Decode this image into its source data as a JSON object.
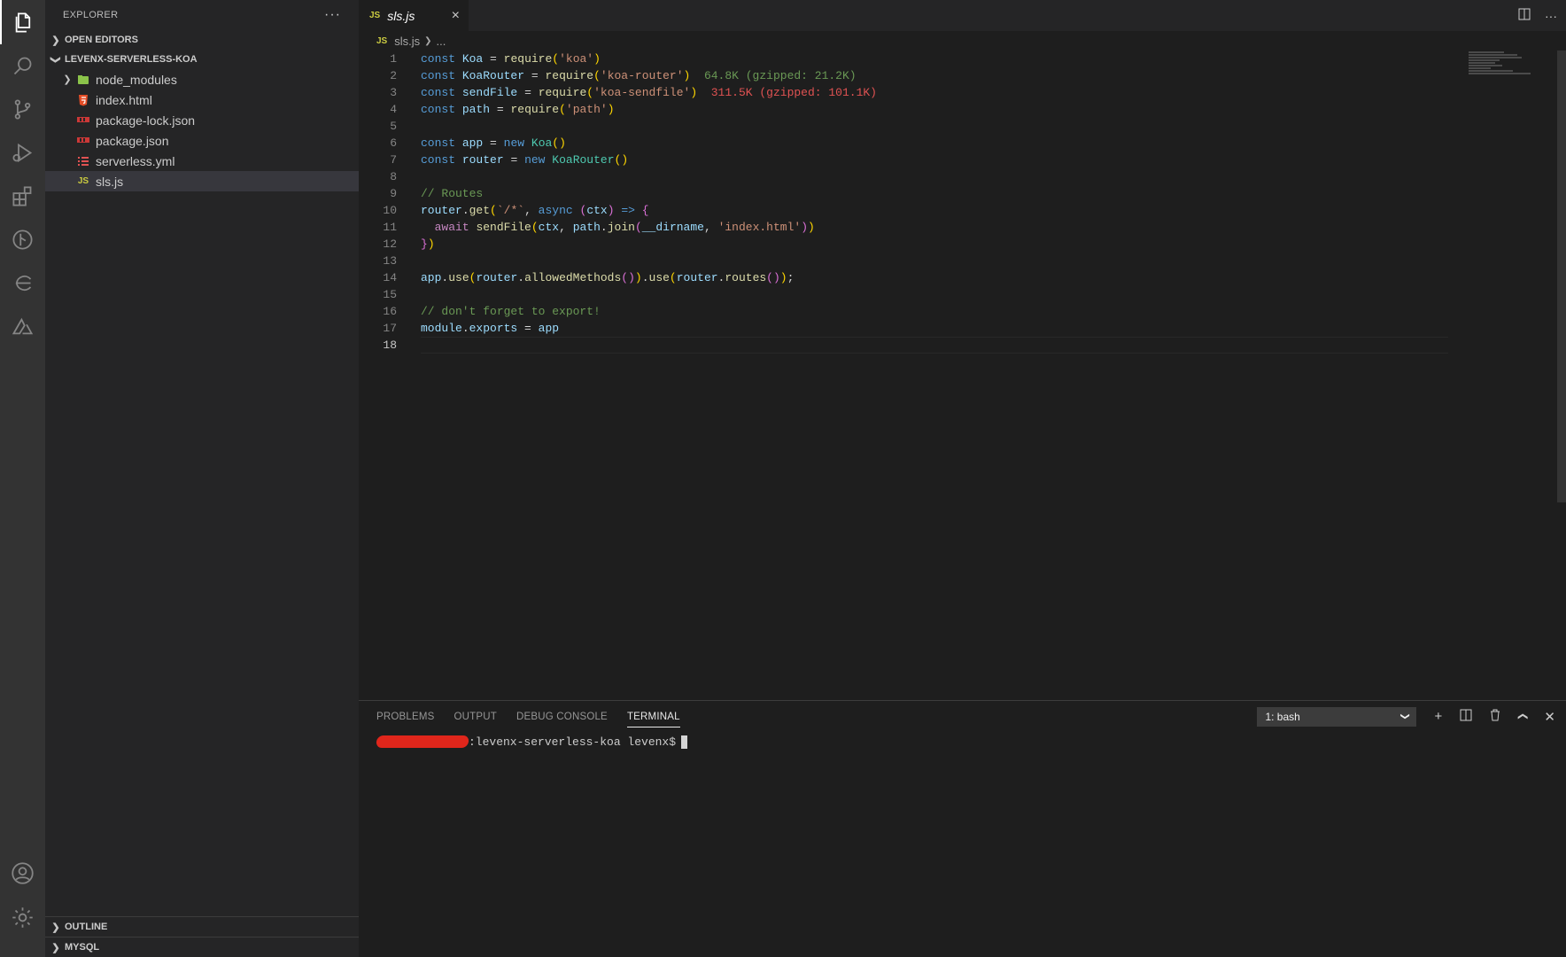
{
  "activity": {
    "icons": [
      "files-icon",
      "search-icon",
      "source-control-icon",
      "run-debug-icon",
      "extensions-icon",
      "git-graph-icon",
      "remote-explorer-icon",
      "azure-icon"
    ],
    "bottom_icons": [
      "account-icon",
      "gear-icon"
    ]
  },
  "sidebar": {
    "title": "EXPLORER",
    "more": "···",
    "open_editors": "OPEN EDITORS",
    "project": "LEVENX-SERVERLESS-KOA",
    "files": [
      {
        "name": "node_modules",
        "icon": "folder-node-icon",
        "kind": "folder"
      },
      {
        "name": "index.html",
        "icon": "html-file-icon",
        "kind": "file"
      },
      {
        "name": "package-lock.json",
        "icon": "npm-file-icon",
        "kind": "file"
      },
      {
        "name": "package.json",
        "icon": "npm-file-icon",
        "kind": "file"
      },
      {
        "name": "serverless.yml",
        "icon": "yaml-file-icon",
        "kind": "file"
      },
      {
        "name": "sls.js",
        "icon": "js-file-icon",
        "kind": "file"
      }
    ],
    "outline": "OUTLINE",
    "mysql": "MYSQL"
  },
  "editor": {
    "tab_label": "sls.js",
    "tab_badge": "JS",
    "close": "×",
    "breadcrumb_file": "sls.js",
    "breadcrumb_rest": "...",
    "line_numbers": [
      "1",
      "2",
      "3",
      "4",
      "5",
      "6",
      "7",
      "8",
      "9",
      "10",
      "11",
      "12",
      "13",
      "14",
      "15",
      "16",
      "17",
      "18"
    ],
    "import_sizes": {
      "koa_router": "64.8K (gzipped: 21.2K)",
      "koa_sendfile": "311.5K (gzipped: 101.1K)"
    }
  },
  "panel": {
    "tabs": [
      "PROBLEMS",
      "OUTPUT",
      "DEBUG CONSOLE",
      "TERMINAL"
    ],
    "active_tab": "TERMINAL",
    "terminal_select": "1: bash",
    "prompt": ":levenx-serverless-koa levenx$"
  },
  "colors": {
    "accent_js": "#cbcb41",
    "redaction": "#e0261b"
  }
}
